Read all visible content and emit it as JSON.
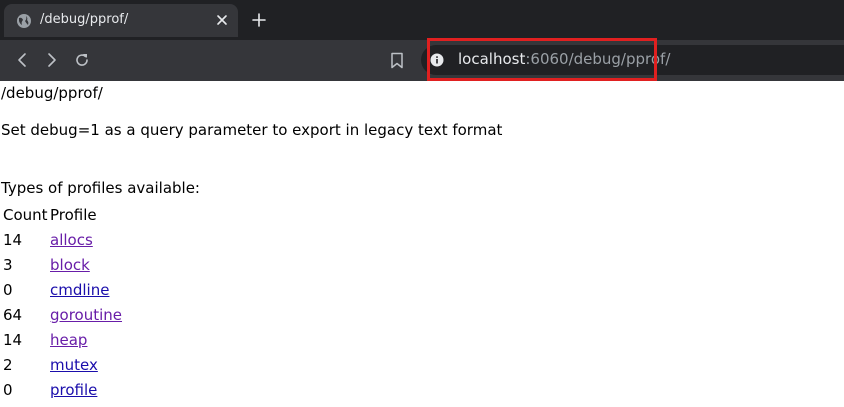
{
  "browser": {
    "tab_title": "/debug/pprof/",
    "url_host": "localhost",
    "url_path": ":6060/debug/pprof/"
  },
  "page": {
    "heading": "/debug/pprof/",
    "debug_note": "Set debug=1 as a query parameter to export in legacy text format",
    "types_label": "Types of profiles available:",
    "table": {
      "headers": [
        "Count",
        "Profile"
      ],
      "rows": [
        {
          "count": "14",
          "profile": "allocs",
          "visited": true
        },
        {
          "count": "3",
          "profile": "block",
          "visited": true
        },
        {
          "count": "0",
          "profile": "cmdline",
          "visited": false
        },
        {
          "count": "64",
          "profile": "goroutine",
          "visited": true
        },
        {
          "count": "14",
          "profile": "heap",
          "visited": true
        },
        {
          "count": "2",
          "profile": "mutex",
          "visited": false
        },
        {
          "count": "0",
          "profile": "profile",
          "visited": false
        }
      ]
    }
  },
  "annotation": {
    "highlight_color": "#e02020"
  },
  "colors": {
    "link": "#1a0dab",
    "visited_link": "#681da8",
    "tabstrip": "#202124",
    "toolbar": "#35363a"
  },
  "icons": {
    "tab_favicon": "globe-icon",
    "tab_close": "close-icon",
    "new_tab": "plus-icon",
    "back": "back-arrow-icon",
    "forward": "forward-arrow-icon",
    "reload": "reload-icon",
    "bookmark": "bookmark-icon",
    "site_info": "info-icon"
  }
}
